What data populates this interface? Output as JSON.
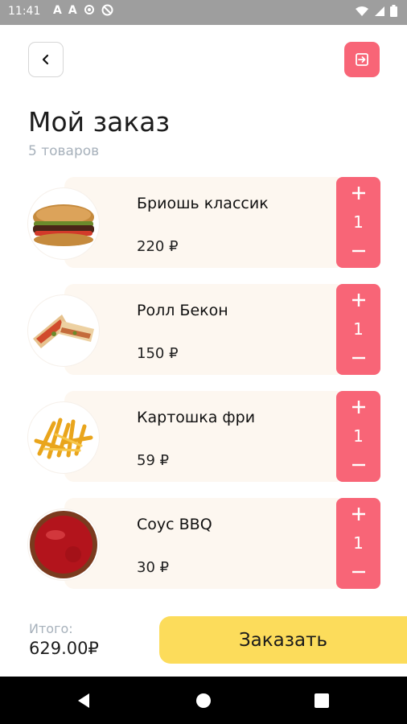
{
  "status_bar": {
    "time": "11:41",
    "left_icons": [
      "A",
      "A"
    ]
  },
  "header": {
    "title": "Мой заказ",
    "subtitle": "5 товаров"
  },
  "items": [
    {
      "name": "Бриошь классик",
      "price": "220 ₽",
      "qty": "1",
      "image": "burger"
    },
    {
      "name": "Ролл Бекон",
      "price": "150 ₽",
      "qty": "1",
      "image": "roll"
    },
    {
      "name": "Картошка фри",
      "price": "59 ₽",
      "qty": "1",
      "image": "fries"
    },
    {
      "name": "Соус BBQ",
      "price": "30 ₽",
      "qty": "1",
      "image": "sauce"
    }
  ],
  "footer": {
    "total_label": "Итого:",
    "total_value": "629.00₽",
    "order_label": "Заказать"
  },
  "colors": {
    "accent": "#f86577",
    "order_button": "#fcdc5b",
    "card_bg": "#fdf7f0",
    "muted_text": "#a7b1bb"
  }
}
